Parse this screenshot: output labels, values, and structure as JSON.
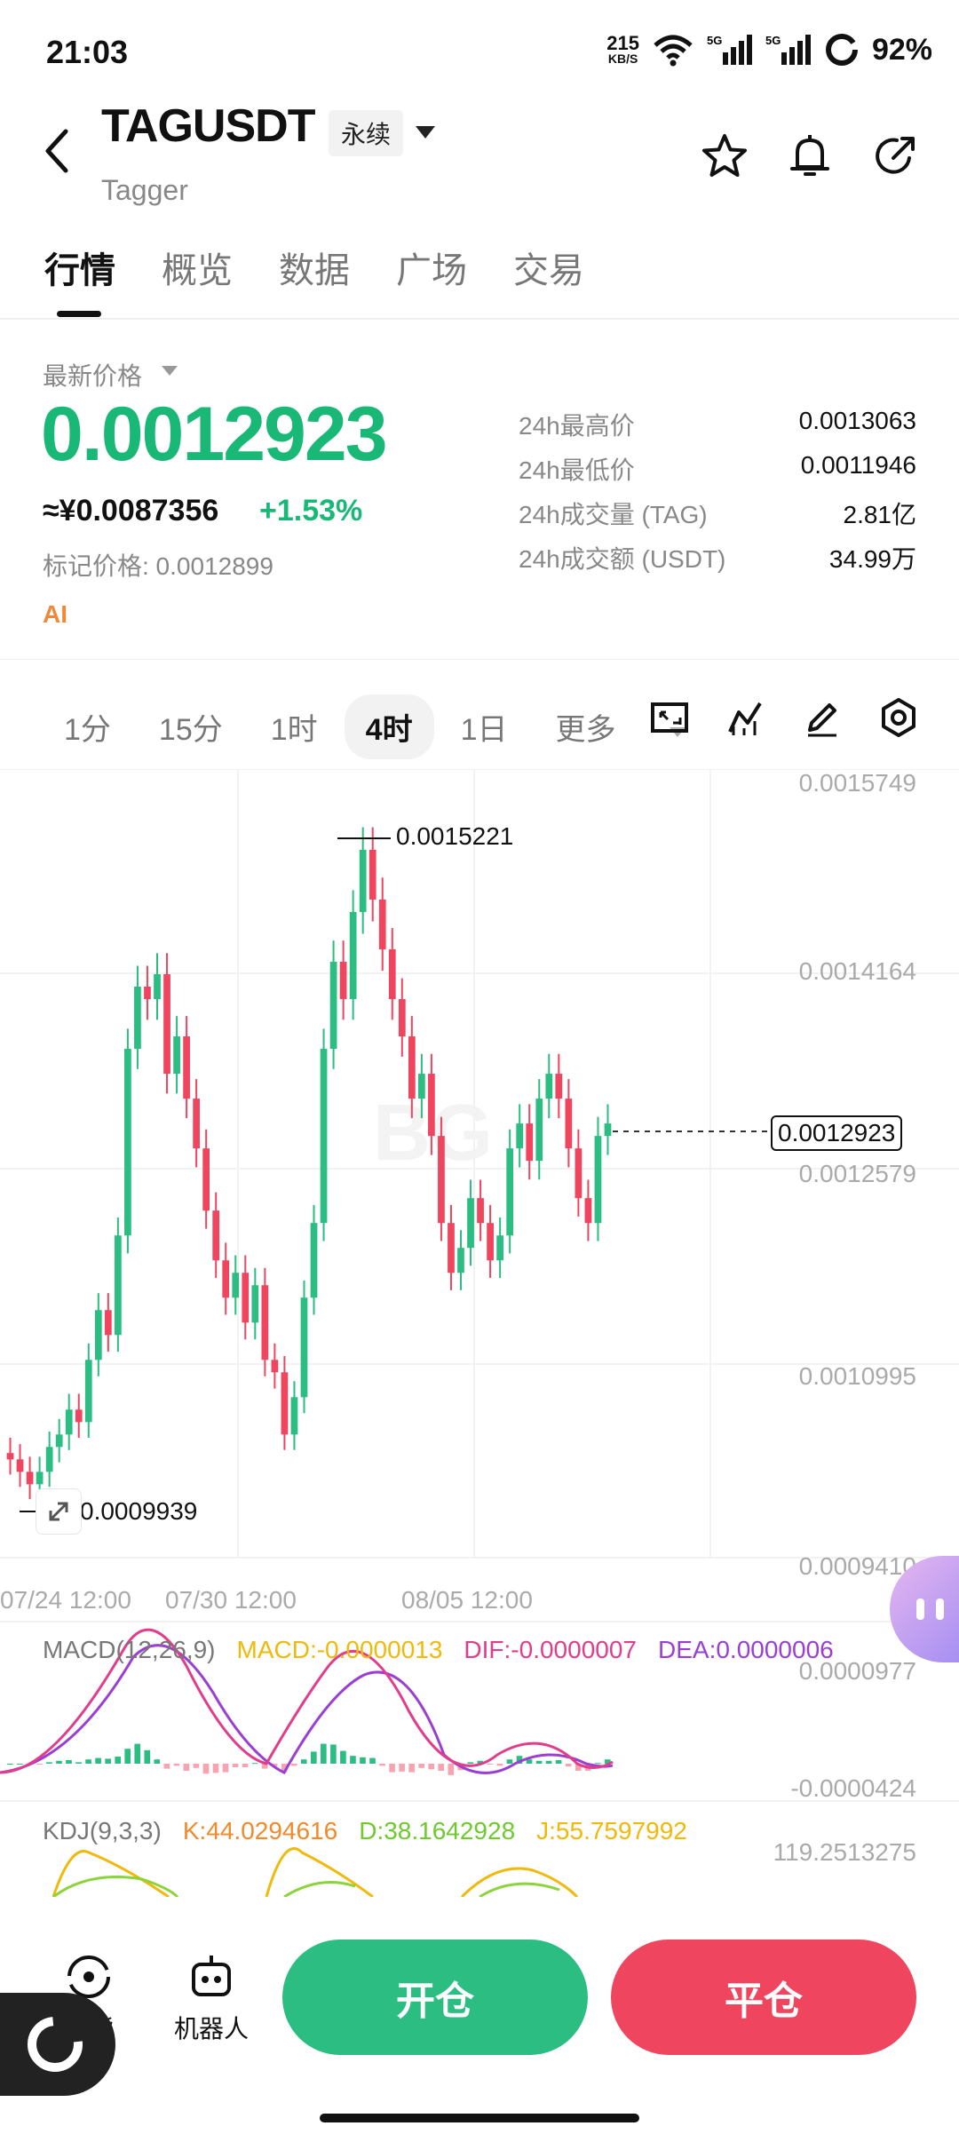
{
  "status_bar": {
    "time": "21:03",
    "speed_value": "215",
    "speed_unit": "KB/S",
    "battery": "92%"
  },
  "header": {
    "title": "TAGUSDT",
    "badge": "永续",
    "subtitle": "Tagger"
  },
  "tabs": [
    {
      "label": "行情",
      "active": true
    },
    {
      "label": "概览"
    },
    {
      "label": "数据"
    },
    {
      "label": "广场"
    },
    {
      "label": "交易"
    }
  ],
  "price": {
    "label": "最新价格",
    "last": "0.0012923",
    "cny": "≈¥0.0087356",
    "change": "+1.53%",
    "mark": "标记价格: 0.0012899",
    "ai": "AI"
  },
  "stats": [
    {
      "k": "24h最高价",
      "v": "0.0013063"
    },
    {
      "k": "24h最低价",
      "v": "0.0011946"
    },
    {
      "k": "24h成交量 (TAG)",
      "v": "2.81亿"
    },
    {
      "k": "24h成交额 (USDT)",
      "v": "34.99万"
    }
  ],
  "intervals": {
    "items": [
      "1分",
      "15分",
      "1时",
      "4时",
      "1日"
    ],
    "active": "4时",
    "more": "更多"
  },
  "chart": {
    "y_ticks": [
      "0.0015749",
      "0.0014164",
      "0.0012579",
      "0.0010995",
      "0.0009410"
    ],
    "x_ticks": [
      "07/24 12:00",
      "07/30 12:00",
      "08/05 12:00"
    ],
    "high_label": "0.0015221",
    "low_label": "0.0009939",
    "current": "0.0012923",
    "macd": {
      "name": "MACD(12,26,9)",
      "macd": "MACD:-0.0000013",
      "dif": "DIF:-0.0000007",
      "dea": "DEA:0.0000006",
      "top": "0.0000977",
      "bottom": "-0.0000424"
    },
    "kdj": {
      "name": "KDJ(9,3,3)",
      "k": "K:44.0294616",
      "d": "D:38.1642928",
      "j": "J:55.7597992",
      "top": "119.2513275"
    }
  },
  "chart_data": {
    "type": "candlestick",
    "ylim": [
      0.000941,
      0.0015749
    ],
    "x_labels": [
      "07/24 12:00",
      "07/30 12:00",
      "08/05 12:00"
    ],
    "high": 0.0015221,
    "low": 0.0009939,
    "last": 0.0012923,
    "close_series": [
      0.00102,
      0.00101,
      0.001,
      0.00101,
      0.00103,
      0.00104,
      0.00106,
      0.00105,
      0.0011,
      0.00114,
      0.00112,
      0.0012,
      0.00135,
      0.0014,
      0.00139,
      0.00141,
      0.00133,
      0.00136,
      0.00131,
      0.00127,
      0.00122,
      0.00118,
      0.00115,
      0.00117,
      0.00113,
      0.00116,
      0.0011,
      0.00109,
      0.00104,
      0.00107,
      0.00115,
      0.00121,
      0.00135,
      0.00142,
      0.00139,
      0.00146,
      0.00151,
      0.00147,
      0.00143,
      0.00139,
      0.00136,
      0.00131,
      0.00133,
      0.00128,
      0.00121,
      0.00117,
      0.00119,
      0.00123,
      0.00121,
      0.00118,
      0.0012,
      0.00127,
      0.00129,
      0.00126,
      0.00131,
      0.00133,
      0.00131,
      0.00127,
      0.00123,
      0.00121,
      0.00128,
      0.00129
    ]
  },
  "bottom_nav": {
    "spot": "现货",
    "bot": "机器人",
    "open": "开仓",
    "close": "平仓"
  }
}
